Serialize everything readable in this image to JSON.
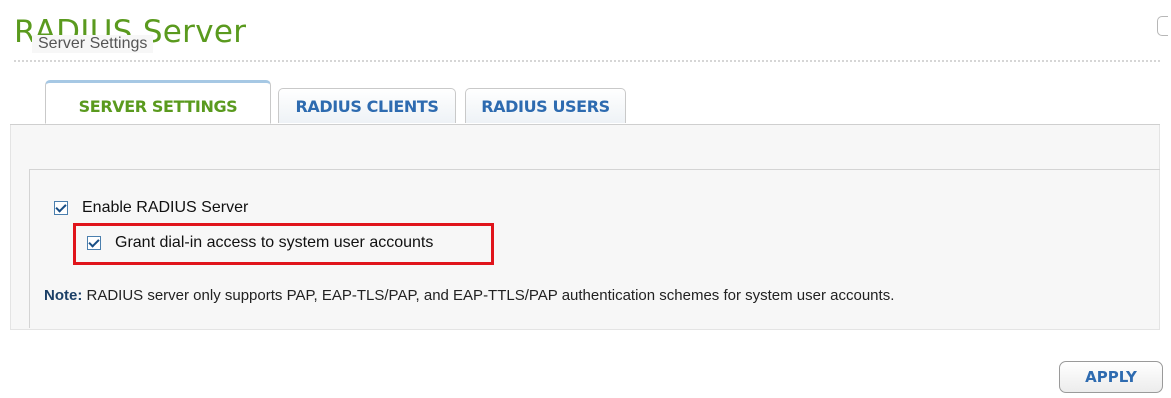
{
  "page": {
    "title": "RADIUS Server"
  },
  "tabs": [
    {
      "label": "SERVER SETTINGS",
      "active": true
    },
    {
      "label": "RADIUS CLIENTS",
      "active": false
    },
    {
      "label": "RADIUS USERS",
      "active": false
    }
  ],
  "server_settings": {
    "legend": "Server Settings",
    "enable_radius": {
      "label": "Enable RADIUS Server",
      "checked": true
    },
    "grant_dialin": {
      "label": "Grant dial-in access to system user accounts",
      "checked": true
    },
    "note_prefix": "Note:",
    "note_text": " RADIUS server only supports PAP, EAP-TLS/PAP, and EAP-TTLS/PAP authentication schemes for system user accounts."
  },
  "actions": {
    "apply_label": "APPLY"
  },
  "colors": {
    "title_green": "#5a9a1e",
    "tab_blue": "#2e6bb0",
    "highlight_red": "#e0141b"
  }
}
